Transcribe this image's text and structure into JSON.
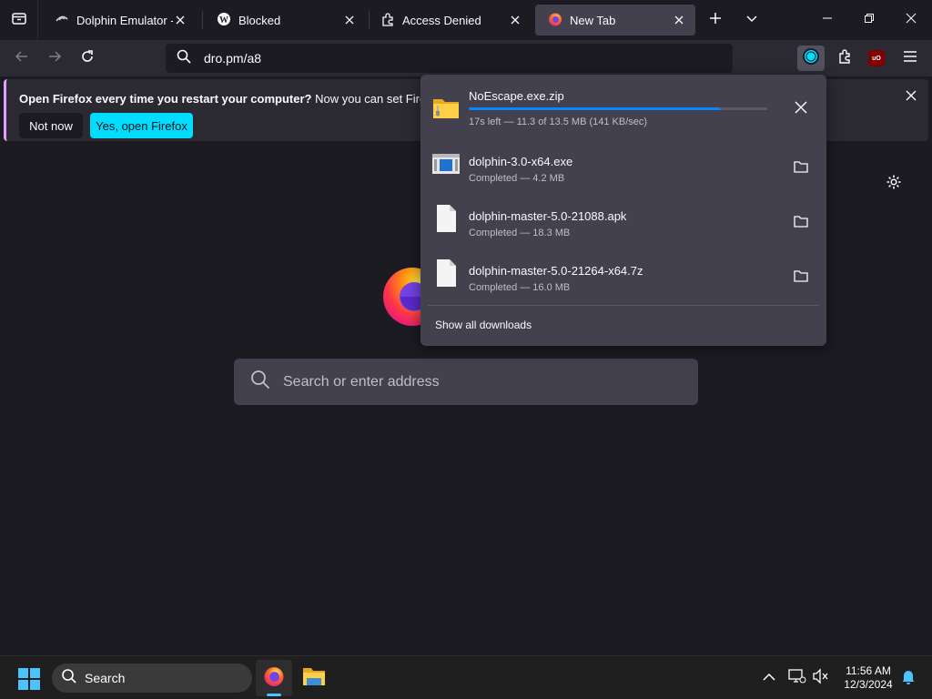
{
  "tabs": [
    {
      "title": "Dolphin Emulator - Rel",
      "icon": "dolphin-icon"
    },
    {
      "title": "Blocked",
      "icon": "wordpress-icon"
    },
    {
      "title": "Access Denied",
      "icon": "puzzle-piece-icon"
    },
    {
      "title": "New Tab",
      "icon": "firefox-icon",
      "active": true
    }
  ],
  "toolbar": {
    "url": "dro.pm/a8",
    "ublock_label": "uO"
  },
  "notice": {
    "bold": "Open Firefox every time you restart your computer?",
    "text": " Now you can set Firefox to o",
    "secondary": "Not now",
    "primary": "Yes, open Firefox"
  },
  "newtab": {
    "search_placeholder": "Search or enter address"
  },
  "downloads": {
    "items": [
      {
        "name": "NoEscape.exe.zip",
        "status": "17s left — 11.3 of 13.5 MB (141 KB/sec)",
        "progress": 0.84,
        "icon": "zip-folder-icon",
        "in_progress": true
      },
      {
        "name": "dolphin-3.0-x64.exe",
        "status": "Completed — 4.2 MB",
        "icon": "exe-file-icon"
      },
      {
        "name": "dolphin-master-5.0-21088.apk",
        "status": "Completed — 18.3 MB",
        "icon": "file-icon"
      },
      {
        "name": "dolphin-master-5.0-21264-x64.7z",
        "status": "Completed — 16.0 MB",
        "icon": "file-icon"
      }
    ],
    "show_all": "Show all downloads"
  },
  "taskbar": {
    "search_label": "Search",
    "time": "11:56 AM",
    "date": "12/3/2024"
  },
  "colors": {
    "accent": "#00ddff",
    "progress": "#0a84ff",
    "notice_border": "#e0a0ff"
  }
}
